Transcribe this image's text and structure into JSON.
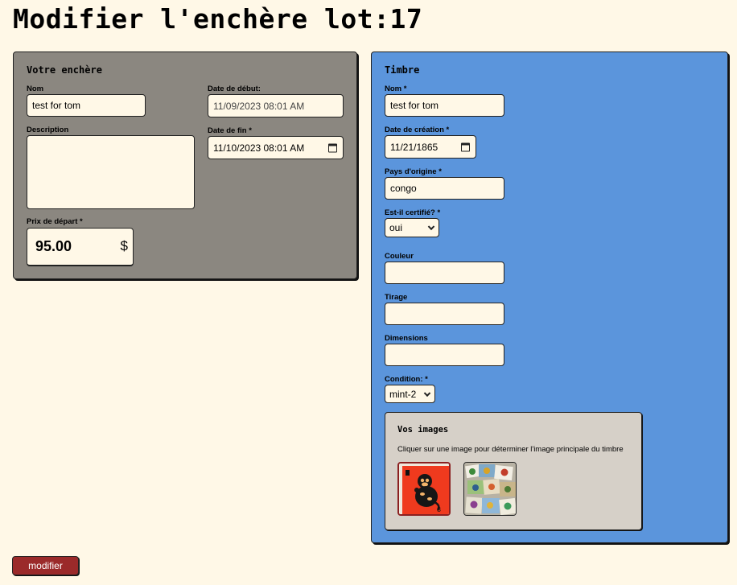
{
  "page": {
    "title": "Modifier l'enchère lot:17"
  },
  "bid_panel": {
    "heading": "Votre enchère",
    "name": {
      "label": "Nom",
      "value": "test for tom"
    },
    "start_date": {
      "label": "Date de début:",
      "value": "11/09/2023 08:01 AM"
    },
    "description": {
      "label": "Description",
      "value": ""
    },
    "end_date": {
      "label": "Date de fin *",
      "value": "11/10/2023 08:01 AM"
    },
    "starting_price": {
      "label": "Prix de départ *",
      "value": "95.00",
      "currency": "$"
    }
  },
  "stamp_panel": {
    "heading": "Timbre",
    "name": {
      "label": "Nom *",
      "value": "test for tom"
    },
    "creation_date": {
      "label": "Date de création *",
      "value": "11/21/1865"
    },
    "country": {
      "label": "Pays d'origine *",
      "value": "congo"
    },
    "certified": {
      "label": "Est-il certifié? *",
      "value": "oui"
    },
    "color": {
      "label": "Couleur",
      "value": ""
    },
    "print_run": {
      "label": "Tirage",
      "value": ""
    },
    "dimensions": {
      "label": "Dimensions",
      "value": ""
    },
    "condition": {
      "label": "Condition: *",
      "value": "mint-2"
    },
    "images": {
      "heading": "Vos images",
      "hint": "Cliquer sur une image pour déterminer l'image principale du timbre",
      "thumbnails": [
        {
          "name": "monkey-stamp",
          "selected": true
        },
        {
          "name": "birds-stamps",
          "selected": false
        }
      ]
    }
  },
  "actions": {
    "submit_label": "modifier"
  },
  "colors": {
    "background": "#fff8e7",
    "bid_panel": "#8b8780",
    "stamp_panel": "#5b95dc",
    "images_box": "#d6d0c8",
    "button": "#9b2a2a",
    "selected_border": "#8b2020"
  }
}
